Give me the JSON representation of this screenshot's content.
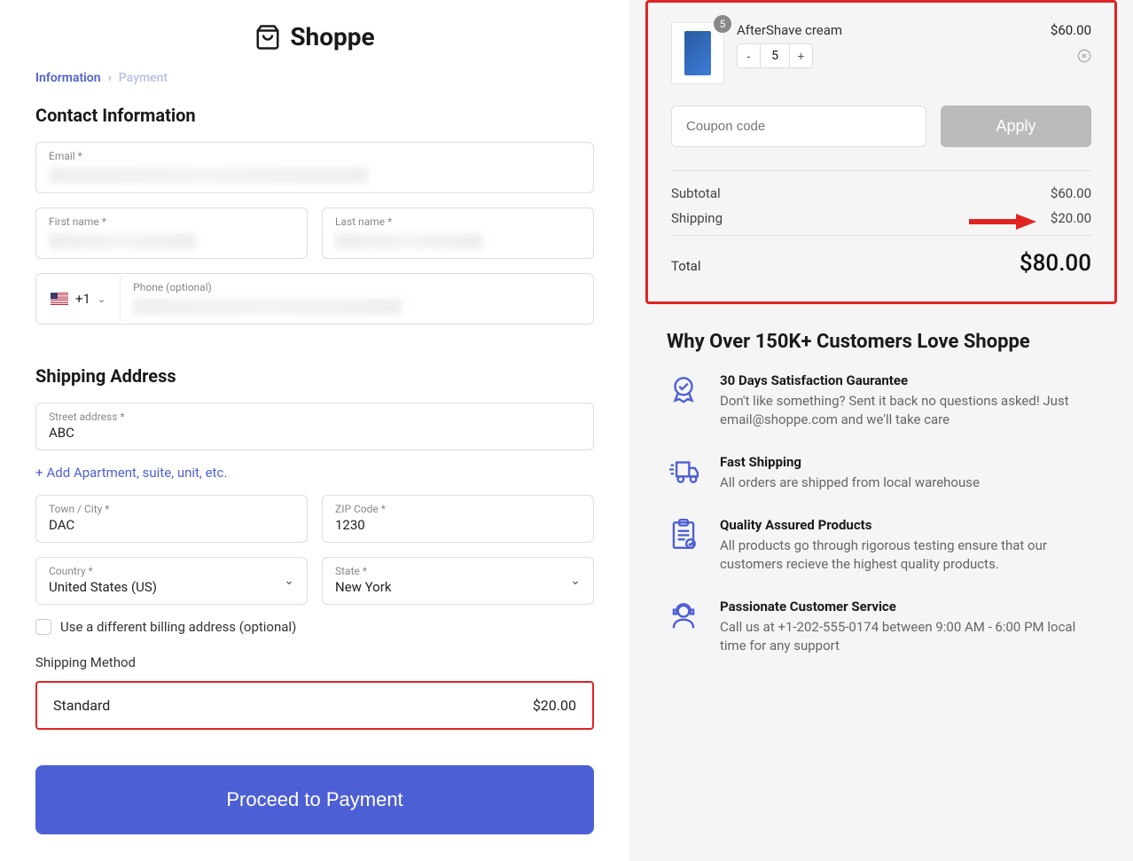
{
  "header": {
    "brand": "Shoppe"
  },
  "breadcrumb": {
    "current": "Information",
    "next": "Payment"
  },
  "contact": {
    "heading": "Contact Information",
    "email_label": "Email *",
    "first_name_label": "First name *",
    "last_name_label": "Last name *",
    "phone_label": "Phone (optional)",
    "phone_prefix": "+1"
  },
  "shipping": {
    "heading": "Shipping Address",
    "street_label": "Street address *",
    "street_value": "ABC",
    "add_apartment": "Add Apartment, suite, unit, etc.",
    "city_label": "Town / City *",
    "city_value": "DAC",
    "zip_label": "ZIP Code *",
    "zip_value": "1230",
    "country_label": "Country *",
    "country_value": "United States (US)",
    "state_label": "State *",
    "state_value": "New York",
    "different_billing": "Use a different billing address (optional)",
    "method_label": "Shipping Method",
    "method_name": "Standard",
    "method_price": "$20.00"
  },
  "cta": {
    "proceed": "Proceed to Payment"
  },
  "cart": {
    "item": {
      "name": "AfterShave cream",
      "price": "$60.00",
      "qty": "5",
      "badge": "5"
    },
    "coupon_placeholder": "Coupon code",
    "apply_label": "Apply",
    "subtotal_label": "Subtotal",
    "subtotal_value": "$60.00",
    "shipping_label": "Shipping",
    "shipping_value": "$20.00",
    "total_label": "Total",
    "total_value": "$80.00"
  },
  "why": {
    "heading": "Why Over 150K+ Customers Love Shoppe",
    "b1_title": "30 Days Satisfaction Gaurantee",
    "b1_desc": "Don't like something? Sent it back no questions asked! Just email@shoppe.com and we'll take care",
    "b2_title": "Fast Shipping",
    "b2_desc": "All orders are shipped from local warehouse",
    "b3_title": "Quality Assured Products",
    "b3_desc": "All products go through rigorous testing ensure that our customers recieve the highest quality products.",
    "b4_title": "Passionate Customer Service",
    "b4_desc": "Call us at +1-202-555-0174 between 9:00 AM - 6:00 PM local time for any support"
  }
}
